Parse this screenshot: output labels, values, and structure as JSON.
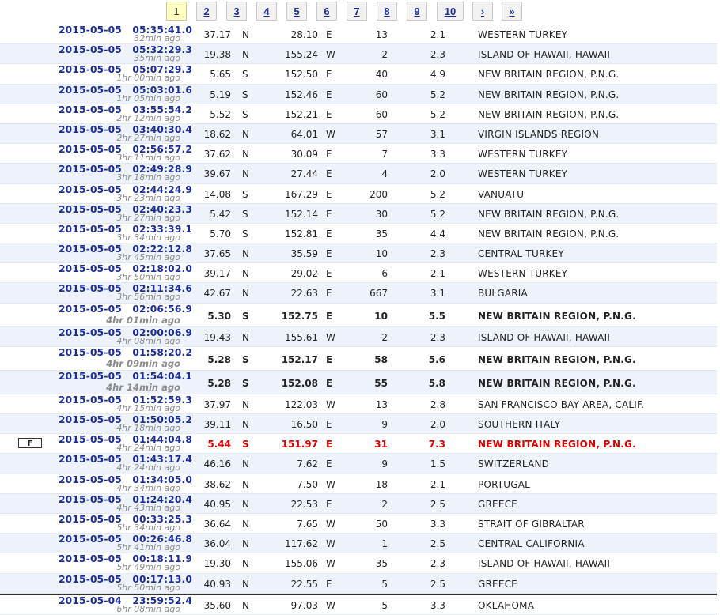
{
  "pagination": {
    "pages": [
      "1",
      "2",
      "3",
      "4",
      "5",
      "6",
      "7",
      "8",
      "9",
      "10"
    ],
    "current": "1",
    "next_label": "›",
    "last_label": "»"
  },
  "flag_label": "F",
  "rows": [
    {
      "date": "2015-05-05",
      "time": "05:35:41.0",
      "ago": "32min ago",
      "lat": "37.17",
      "ns": "N",
      "lon": "28.10",
      "ew": "E",
      "depth": "13",
      "mag": "2.1",
      "region": "WESTERN TURKEY"
    },
    {
      "date": "2015-05-05",
      "time": "05:32:29.3",
      "ago": "35min ago",
      "lat": "19.38",
      "ns": "N",
      "lon": "155.24",
      "ew": "W",
      "depth": "2",
      "mag": "2.3",
      "region": "ISLAND OF HAWAII, HAWAII"
    },
    {
      "date": "2015-05-05",
      "time": "05:07:29.3",
      "ago": "1hr 00min ago",
      "lat": "5.65",
      "ns": "S",
      "lon": "152.50",
      "ew": "E",
      "depth": "40",
      "mag": "4.9",
      "region": "NEW BRITAIN REGION, P.N.G."
    },
    {
      "date": "2015-05-05",
      "time": "05:03:01.6",
      "ago": "1hr 05min ago",
      "lat": "5.19",
      "ns": "S",
      "lon": "152.46",
      "ew": "E",
      "depth": "60",
      "mag": "5.2",
      "region": "NEW BRITAIN REGION, P.N.G."
    },
    {
      "date": "2015-05-05",
      "time": "03:55:54.2",
      "ago": "2hr 12min ago",
      "lat": "5.52",
      "ns": "S",
      "lon": "152.21",
      "ew": "E",
      "depth": "60",
      "mag": "5.2",
      "region": "NEW BRITAIN REGION, P.N.G."
    },
    {
      "date": "2015-05-05",
      "time": "03:40:30.4",
      "ago": "2hr 27min ago",
      "lat": "18.62",
      "ns": "N",
      "lon": "64.01",
      "ew": "W",
      "depth": "57",
      "mag": "3.1",
      "region": "VIRGIN ISLANDS REGION"
    },
    {
      "date": "2015-05-05",
      "time": "02:56:57.2",
      "ago": "3hr 11min ago",
      "lat": "37.62",
      "ns": "N",
      "lon": "30.09",
      "ew": "E",
      "depth": "7",
      "mag": "3.3",
      "region": "WESTERN TURKEY"
    },
    {
      "date": "2015-05-05",
      "time": "02:49:28.9",
      "ago": "3hr 18min ago",
      "lat": "39.67",
      "ns": "N",
      "lon": "27.44",
      "ew": "E",
      "depth": "4",
      "mag": "2.0",
      "region": "WESTERN TURKEY"
    },
    {
      "date": "2015-05-05",
      "time": "02:44:24.9",
      "ago": "3hr 23min ago",
      "lat": "14.08",
      "ns": "S",
      "lon": "167.29",
      "ew": "E",
      "depth": "200",
      "mag": "5.2",
      "region": "VANUATU"
    },
    {
      "date": "2015-05-05",
      "time": "02:40:23.3",
      "ago": "3hr 27min ago",
      "lat": "5.42",
      "ns": "S",
      "lon": "152.14",
      "ew": "E",
      "depth": "30",
      "mag": "5.2",
      "region": "NEW BRITAIN REGION, P.N.G."
    },
    {
      "date": "2015-05-05",
      "time": "02:33:39.1",
      "ago": "3hr 34min ago",
      "lat": "5.70",
      "ns": "S",
      "lon": "152.81",
      "ew": "E",
      "depth": "35",
      "mag": "4.4",
      "region": "NEW BRITAIN REGION, P.N.G."
    },
    {
      "date": "2015-05-05",
      "time": "02:22:12.8",
      "ago": "3hr 45min ago",
      "lat": "37.65",
      "ns": "N",
      "lon": "35.59",
      "ew": "E",
      "depth": "10",
      "mag": "2.3",
      "region": "CENTRAL TURKEY"
    },
    {
      "date": "2015-05-05",
      "time": "02:18:02.0",
      "ago": "3hr 50min ago",
      "lat": "39.17",
      "ns": "N",
      "lon": "29.02",
      "ew": "E",
      "depth": "6",
      "mag": "2.1",
      "region": "WESTERN TURKEY"
    },
    {
      "date": "2015-05-05",
      "time": "02:11:34.6",
      "ago": "3hr 56min ago",
      "lat": "42.67",
      "ns": "N",
      "lon": "22.63",
      "ew": "E",
      "depth": "667",
      "mag": "3.1",
      "region": "BULGARIA"
    },
    {
      "date": "2015-05-05",
      "time": "02:06:56.9",
      "ago": "4hr 01min ago",
      "lat": "5.30",
      "ns": "S",
      "lon": "152.75",
      "ew": "E",
      "depth": "10",
      "mag": "5.5",
      "region": "NEW BRITAIN REGION, P.N.G.",
      "big": true
    },
    {
      "date": "2015-05-05",
      "time": "02:00:06.9",
      "ago": "4hr 08min ago",
      "lat": "19.43",
      "ns": "N",
      "lon": "155.61",
      "ew": "W",
      "depth": "2",
      "mag": "2.3",
      "region": "ISLAND OF HAWAII, HAWAII"
    },
    {
      "date": "2015-05-05",
      "time": "01:58:20.2",
      "ago": "4hr 09min ago",
      "lat": "5.28",
      "ns": "S",
      "lon": "152.17",
      "ew": "E",
      "depth": "58",
      "mag": "5.6",
      "region": "NEW BRITAIN REGION, P.N.G.",
      "big": true
    },
    {
      "date": "2015-05-05",
      "time": "01:54:04.1",
      "ago": "4hr 14min ago",
      "lat": "5.28",
      "ns": "S",
      "lon": "152.08",
      "ew": "E",
      "depth": "55",
      "mag": "5.8",
      "region": "NEW BRITAIN REGION, P.N.G.",
      "big": true
    },
    {
      "date": "2015-05-05",
      "time": "01:52:59.3",
      "ago": "4hr 15min ago",
      "lat": "37.97",
      "ns": "N",
      "lon": "122.03",
      "ew": "W",
      "depth": "13",
      "mag": "2.8",
      "region": "SAN FRANCISCO BAY AREA, CALIF."
    },
    {
      "date": "2015-05-05",
      "time": "01:50:05.2",
      "ago": "4hr 18min ago",
      "lat": "39.11",
      "ns": "N",
      "lon": "16.50",
      "ew": "E",
      "depth": "9",
      "mag": "2.0",
      "region": "SOUTHERN ITALY"
    },
    {
      "date": "2015-05-05",
      "time": "01:44:04.8",
      "ago": "4hr 24min ago",
      "lat": "5.44",
      "ns": "S",
      "lon": "151.97",
      "ew": "E",
      "depth": "31",
      "mag": "7.3",
      "region": "NEW BRITAIN REGION, P.N.G.",
      "selected": true
    },
    {
      "date": "2015-05-05",
      "time": "01:43:17.4",
      "ago": "4hr 24min ago",
      "lat": "46.16",
      "ns": "N",
      "lon": "7.62",
      "ew": "E",
      "depth": "9",
      "mag": "1.5",
      "region": "SWITZERLAND"
    },
    {
      "date": "2015-05-05",
      "time": "01:34:05.0",
      "ago": "4hr 34min ago",
      "lat": "38.62",
      "ns": "N",
      "lon": "7.50",
      "ew": "W",
      "depth": "18",
      "mag": "2.1",
      "region": "PORTUGAL"
    },
    {
      "date": "2015-05-05",
      "time": "01:24:20.4",
      "ago": "4hr 43min ago",
      "lat": "40.95",
      "ns": "N",
      "lon": "22.53",
      "ew": "E",
      "depth": "2",
      "mag": "2.5",
      "region": "GREECE"
    },
    {
      "date": "2015-05-05",
      "time": "00:33:25.3",
      "ago": "5hr 34min ago",
      "lat": "36.64",
      "ns": "N",
      "lon": "7.65",
      "ew": "W",
      "depth": "50",
      "mag": "3.3",
      "region": "STRAIT OF GIBRALTAR"
    },
    {
      "date": "2015-05-05",
      "time": "00:26:46.8",
      "ago": "5hr 41min ago",
      "lat": "36.04",
      "ns": "N",
      "lon": "117.62",
      "ew": "W",
      "depth": "1",
      "mag": "2.5",
      "region": "CENTRAL CALIFORNIA"
    },
    {
      "date": "2015-05-05",
      "time": "00:18:11.9",
      "ago": "5hr 49min ago",
      "lat": "19.30",
      "ns": "N",
      "lon": "155.06",
      "ew": "W",
      "depth": "35",
      "mag": "2.3",
      "region": "ISLAND OF HAWAII, HAWAII"
    },
    {
      "date": "2015-05-05",
      "time": "00:17:13.0",
      "ago": "5hr 50min ago",
      "lat": "40.93",
      "ns": "N",
      "lon": "22.55",
      "ew": "E",
      "depth": "5",
      "mag": "2.5",
      "region": "GREECE"
    },
    {
      "date": "2015-05-04",
      "time": "23:59:52.4",
      "ago": "6hr 08min ago",
      "lat": "35.60",
      "ns": "N",
      "lon": "97.03",
      "ew": "W",
      "depth": "5",
      "mag": "3.3",
      "region": "OKLAHOMA",
      "after_separator": true
    }
  ]
}
